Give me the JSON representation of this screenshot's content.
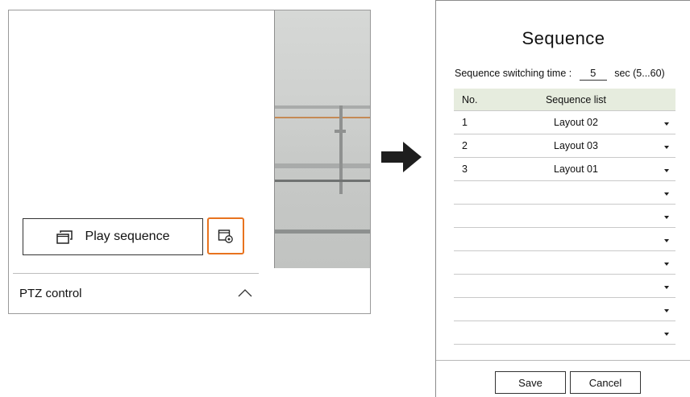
{
  "left_panel": {
    "play_sequence_label": "Play sequence",
    "play_sequence_icon": "windows-stack-icon",
    "sequence_settings_icon": "window-gear-icon",
    "ptz_label": "PTZ control",
    "ptz_icon": "chevron-up-icon",
    "highlight_color": "#e8731f"
  },
  "arrow_icon": "right-arrow-icon",
  "dialog": {
    "title": "Sequence",
    "switching_label": "Sequence switching time :",
    "switching_value": "5",
    "switching_unit": "sec (5...60)",
    "columns": {
      "no": "No.",
      "list": "Sequence list"
    },
    "rows": [
      {
        "no": "1",
        "layout": "Layout 02"
      },
      {
        "no": "2",
        "layout": "Layout 03"
      },
      {
        "no": "3",
        "layout": "Layout 01"
      },
      {
        "no": "",
        "layout": ""
      },
      {
        "no": "",
        "layout": ""
      },
      {
        "no": "",
        "layout": ""
      },
      {
        "no": "",
        "layout": ""
      },
      {
        "no": "",
        "layout": ""
      },
      {
        "no": "",
        "layout": ""
      },
      {
        "no": "",
        "layout": ""
      }
    ],
    "dropdown_icon": "caret-down-icon",
    "header_color": "#e6ecde",
    "save_label": "Save",
    "cancel_label": "Cancel"
  }
}
